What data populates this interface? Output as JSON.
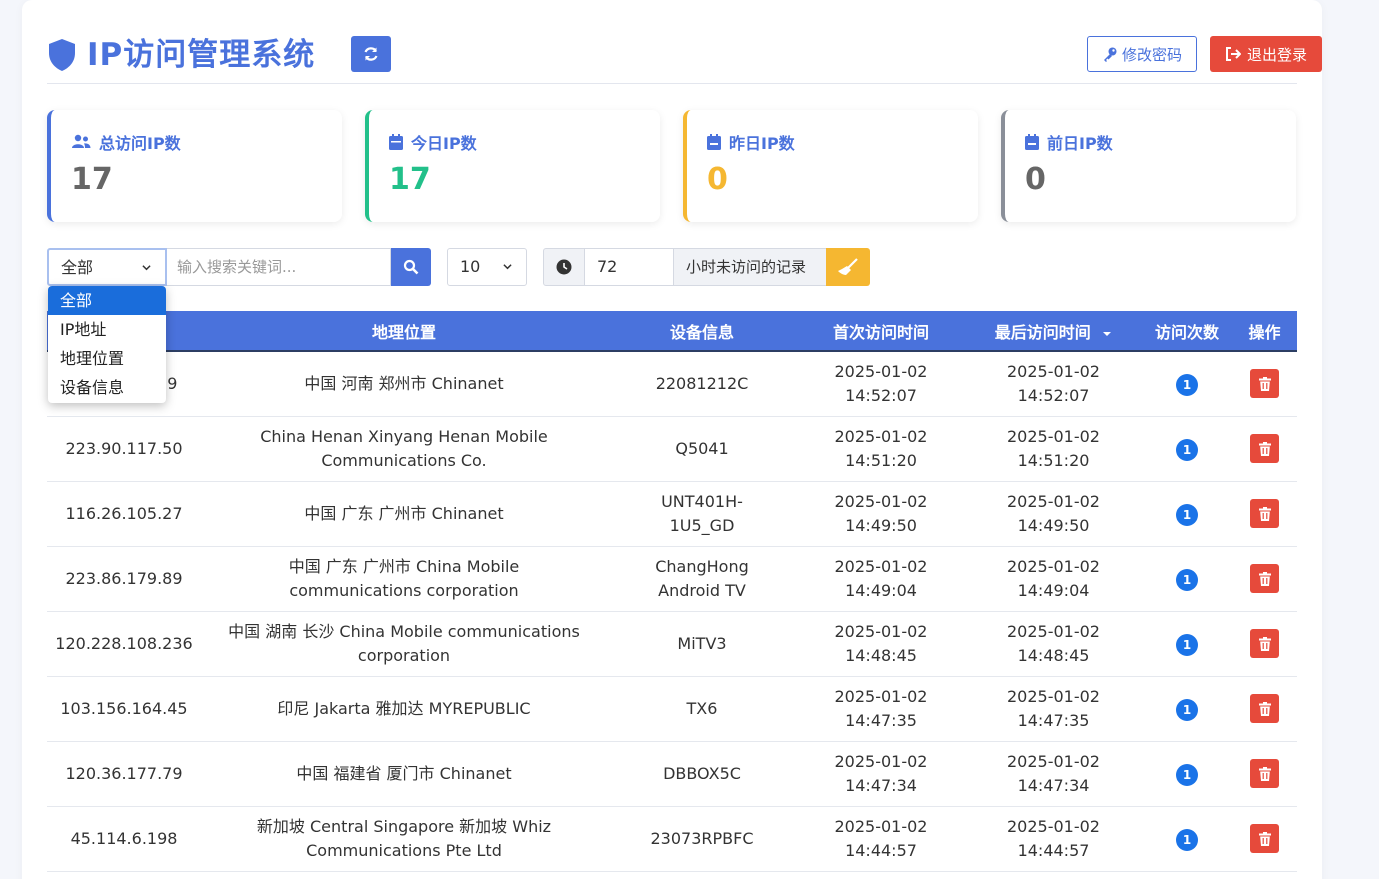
{
  "header": {
    "title": "IP访问管理系统",
    "change_password": "修改密码",
    "logout": "退出登录"
  },
  "stats": [
    {
      "label": "总访问IP数",
      "value": "17",
      "color": "#4a72dc",
      "value_color": "#666666",
      "icon": "users-icon"
    },
    {
      "label": "今日IP数",
      "value": "17",
      "color": "#22c08a",
      "value_color": "#22c08a",
      "icon": "calendar-icon"
    },
    {
      "label": "昨日IP数",
      "value": "0",
      "color": "#f5b731",
      "value_color": "#f5b731",
      "icon": "calendar-minus-icon"
    },
    {
      "label": "前日IP数",
      "value": "0",
      "color": "#8a8f99",
      "value_color": "#666666",
      "icon": "calendar-minus-icon"
    }
  ],
  "filters": {
    "field_selected": "全部",
    "field_options": [
      "全部",
      "IP地址",
      "地理位置",
      "设备信息"
    ],
    "search_placeholder": "输入搜索关键词...",
    "per_page": "10",
    "hours_value": "72",
    "hours_label": "小时未访问的记录"
  },
  "table": {
    "columns": [
      "IP地址",
      "地理位置",
      "设备信息",
      "首次访问时间",
      "最后访问时间",
      "访问次数",
      "操作"
    ],
    "rows": [
      {
        "ip": "119.4.40.179",
        "location": "中国 河南 郑州市 Chinanet",
        "device": "22081212C",
        "first_date": "2025-01-02",
        "first_time": "14:52:07",
        "last_date": "2025-01-02",
        "last_time": "14:52:07",
        "count": "1"
      },
      {
        "ip": "223.90.117.50",
        "location": "China Henan Xinyang Henan Mobile Communications Co.",
        "device": "Q5041",
        "first_date": "2025-01-02",
        "first_time": "14:51:20",
        "last_date": "2025-01-02",
        "last_time": "14:51:20",
        "count": "1"
      },
      {
        "ip": "116.26.105.27",
        "location": "中国 广东 广州市 Chinanet",
        "device": "UNT401H-1U5_GD",
        "first_date": "2025-01-02",
        "first_time": "14:49:50",
        "last_date": "2025-01-02",
        "last_time": "14:49:50",
        "count": "1"
      },
      {
        "ip": "223.86.179.89",
        "location": "中国 广东 广州市 China Mobile communications corporation",
        "device": "ChangHong Android TV",
        "first_date": "2025-01-02",
        "first_time": "14:49:04",
        "last_date": "2025-01-02",
        "last_time": "14:49:04",
        "count": "1"
      },
      {
        "ip": "120.228.108.236",
        "location": "中国 湖南 长沙 China Mobile communications corporation",
        "device": "MiTV3",
        "first_date": "2025-01-02",
        "first_time": "14:48:45",
        "last_date": "2025-01-02",
        "last_time": "14:48:45",
        "count": "1"
      },
      {
        "ip": "103.156.164.45",
        "location": "印尼 Jakarta 雅加达 MYREPUBLIC",
        "device": "TX6",
        "first_date": "2025-01-02",
        "first_time": "14:47:35",
        "last_date": "2025-01-02",
        "last_time": "14:47:35",
        "count": "1"
      },
      {
        "ip": "120.36.177.79",
        "location": "中国 福建省 厦门市 Chinanet",
        "device": "DBBOX5C",
        "first_date": "2025-01-02",
        "first_time": "14:47:34",
        "last_date": "2025-01-02",
        "last_time": "14:47:34",
        "count": "1"
      },
      {
        "ip": "45.114.6.198",
        "location": "新加坡 Central Singapore 新加坡 Whiz Communications Pte Ltd",
        "device": "23073RPBFC",
        "first_date": "2025-01-02",
        "first_time": "14:44:57",
        "last_date": "2025-01-02",
        "last_time": "14:44:57",
        "count": "1"
      }
    ]
  }
}
